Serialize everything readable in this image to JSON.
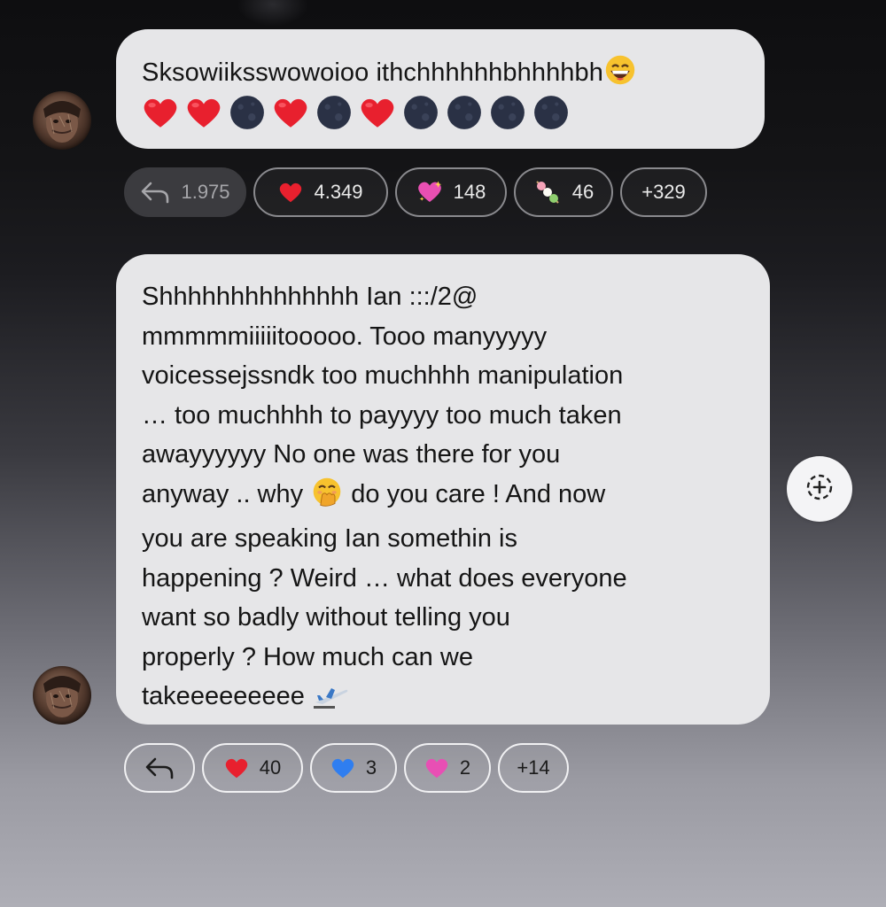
{
  "messages": [
    {
      "text_line1": "Sksowiiksswowoioo ithchhhhhhbhhhhbh",
      "emoji_sequence": [
        "heart",
        "heart",
        "moon",
        "heart",
        "moon",
        "heart",
        "moon",
        "moon",
        "moon",
        "moon"
      ],
      "reactions": {
        "reply_count": "1.975",
        "items": [
          {
            "emoji": "red-heart",
            "count": "4.349"
          },
          {
            "emoji": "sparkling-heart",
            "count": "148"
          },
          {
            "emoji": "dango",
            "count": "46"
          }
        ],
        "more": "+329"
      }
    },
    {
      "lines": [
        "Shhhhhhhhhhhhhh Ian :::/2@",
        "mmmmmiiiiitooooo.  Tooo manyyyyy",
        "voicessejssndk too muchhhh manipulation",
        "… too muchhhh to payyyy too much taken",
        "awayyyyyy   No one was there for you",
        "anyway .. why",
        "do you care !  And now",
        "you are speaking Ian somethin is",
        "happening ? Weird … what does everyone",
        "want so badly without telling you",
        "properly ? How much can we",
        "takeeeeeeeee"
      ],
      "reactions": {
        "items": [
          {
            "emoji": "red-heart",
            "count": "40"
          },
          {
            "emoji": "blue-heart",
            "count": "3"
          },
          {
            "emoji": "pink-heart",
            "count": "2"
          }
        ],
        "more": "+14"
      }
    }
  ],
  "colors": {
    "bubble": "#e6e6e8",
    "red_heart": "#e8202e",
    "blue_heart": "#2f7ef0",
    "pink_heart": "#e84fb4"
  }
}
